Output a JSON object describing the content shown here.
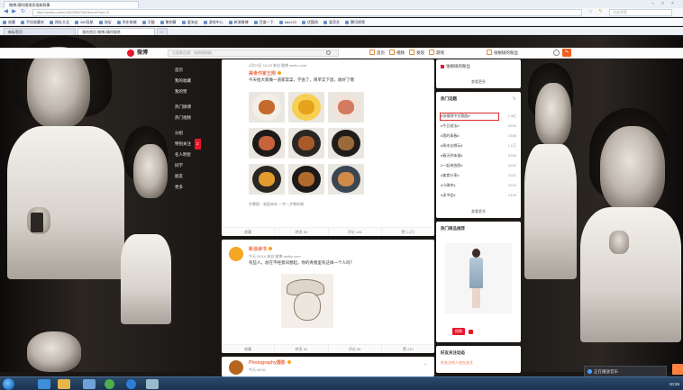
{
  "browser": {
    "window_tab_title": "微博-随时随地发现新鲜事",
    "url": "http://weibo.com/u/5223567381/home?wvr=5",
    "search_placeholder": "点此搜索",
    "bookmarks": [
      "收藏",
      "手机收藏夹",
      "网址大全",
      "360导航",
      "淘宝",
      "京东商城",
      "天猫",
      "聚划算",
      "爱淘宝",
      "游戏中心",
      "新浪微博",
      "百度一下",
      "hao123",
      "优酷网",
      "爱奇艺",
      "腾讯视频"
    ],
    "tabs": [
      {
        "label": "新标签页",
        "active": false
      },
      {
        "label": "我的首页 微博-随时随地",
        "active": true
      },
      {
        "label": "+",
        "active": false
      }
    ]
  },
  "weibo_nav": {
    "logo_text": "微博",
    "search_placeholder": "大家都在搜：张根硕新剧",
    "links": [
      "首页",
      "视频",
      "发现",
      "游戏"
    ],
    "username": "张根硕的粉丝"
  },
  "left_nav": {
    "items": [
      {
        "label": "首页",
        "group": false
      },
      {
        "label": "我的收藏",
        "group": false
      },
      {
        "label": "我的赞",
        "group": false
      },
      {
        "label": "热门微博",
        "group": true
      },
      {
        "label": "热门视频",
        "group": false
      },
      {
        "label": "分组",
        "group": true
      },
      {
        "label": "特别关注",
        "group": false,
        "count": "2"
      },
      {
        "label": "名人明星",
        "group": false
      },
      {
        "label": "同学",
        "group": false
      },
      {
        "label": "朋友",
        "group": false
      },
      {
        "label": "更多",
        "group": false
      }
    ]
  },
  "feed": {
    "post1": {
      "top_meta": "4月23日 10:25 来自 微博 weibo.com",
      "author_line": "美食作家王刚",
      "text": "今天给大家做一道家常菜，学会了，简单又下饭，收好了哦",
      "caption": "步骤图：香菇肉末 一步一步教你做",
      "actions": [
        "收藏",
        "转发 95",
        "评论 128",
        "赞 1.2万"
      ]
    },
    "post2": {
      "author": "新浪读书",
      "meta": "今天 09:14 来自 微博 weibo.com",
      "text": "有些人，总在不经意间想起。你的青春里有这样一个人吗？",
      "actions": [
        "收藏",
        "转发 34",
        "评论 56",
        "赞 210"
      ]
    },
    "post3": {
      "author": "Photography摄影",
      "meta": "今天 08:51"
    }
  },
  "right": {
    "box1": {
      "title": "张根硕的粉丝",
      "more": "查看更多"
    },
    "hot": {
      "title": "热门话题",
      "rows": [
        {
          "label": "#张根硕中文歌曲#",
          "num": "2.3亿"
        },
        {
          "label": "#今日说法#",
          "num": "9876"
        },
        {
          "label": "#我的青春#",
          "num": "3456"
        },
        {
          "label": "#周末去哪玩#",
          "num": "1.2万"
        },
        {
          "label": "#春天的味道#",
          "num": "8765"
        },
        {
          "label": "#一起来拍照#",
          "num": "5432"
        },
        {
          "label": "#美食分享#",
          "num": "4321"
        },
        {
          "label": "#小确幸#",
          "num": "3210"
        },
        {
          "label": "#读书会#",
          "num": "2109"
        }
      ],
      "more": "查看更多"
    },
    "ad": {
      "title": "热门商品推荐",
      "button": "抢购"
    },
    "box4": {
      "title": "好友关注动态",
      "row": "你关注的人也在关注"
    }
  },
  "notify": {
    "text": "正在播放音乐"
  },
  "taskbar": {
    "clock": "10:26"
  }
}
